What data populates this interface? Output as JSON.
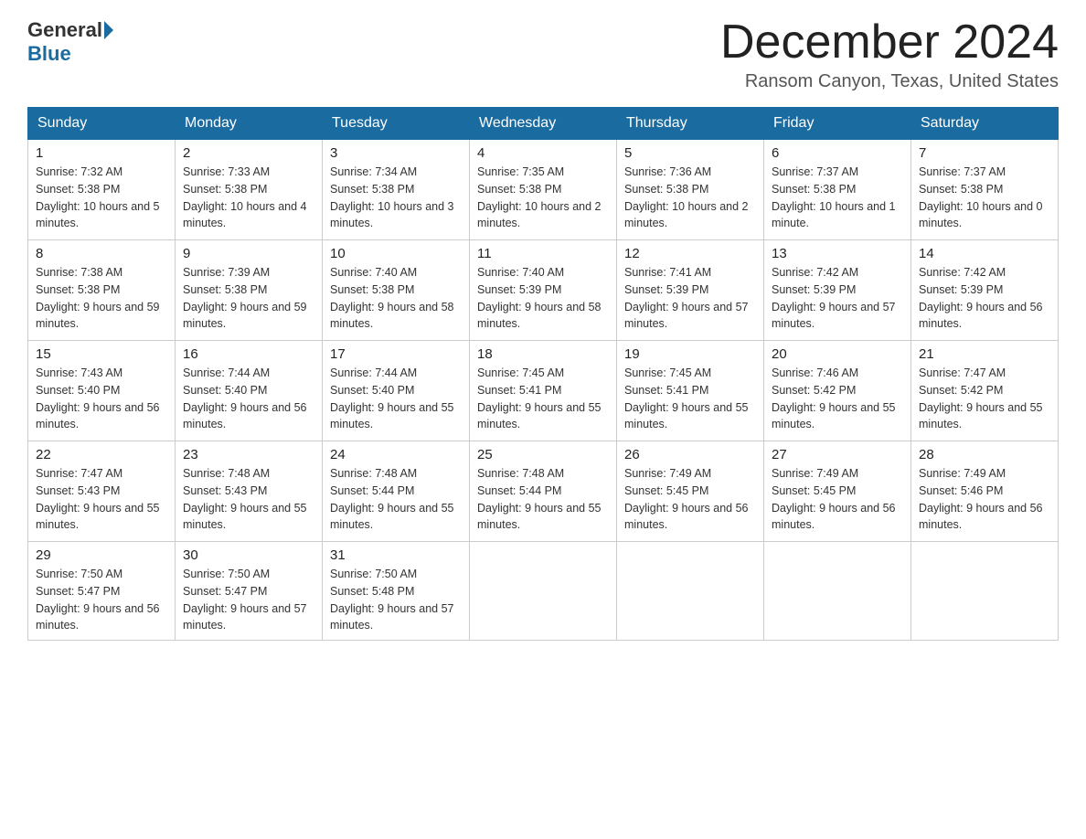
{
  "header": {
    "logo_general": "General",
    "logo_blue": "Blue",
    "title": "December 2024",
    "location": "Ransom Canyon, Texas, United States"
  },
  "weekdays": [
    "Sunday",
    "Monday",
    "Tuesday",
    "Wednesday",
    "Thursday",
    "Friday",
    "Saturday"
  ],
  "weeks": [
    [
      {
        "day": "1",
        "sunrise": "7:32 AM",
        "sunset": "5:38 PM",
        "daylight": "10 hours and 5 minutes."
      },
      {
        "day": "2",
        "sunrise": "7:33 AM",
        "sunset": "5:38 PM",
        "daylight": "10 hours and 4 minutes."
      },
      {
        "day": "3",
        "sunrise": "7:34 AM",
        "sunset": "5:38 PM",
        "daylight": "10 hours and 3 minutes."
      },
      {
        "day": "4",
        "sunrise": "7:35 AM",
        "sunset": "5:38 PM",
        "daylight": "10 hours and 2 minutes."
      },
      {
        "day": "5",
        "sunrise": "7:36 AM",
        "sunset": "5:38 PM",
        "daylight": "10 hours and 2 minutes."
      },
      {
        "day": "6",
        "sunrise": "7:37 AM",
        "sunset": "5:38 PM",
        "daylight": "10 hours and 1 minute."
      },
      {
        "day": "7",
        "sunrise": "7:37 AM",
        "sunset": "5:38 PM",
        "daylight": "10 hours and 0 minutes."
      }
    ],
    [
      {
        "day": "8",
        "sunrise": "7:38 AM",
        "sunset": "5:38 PM",
        "daylight": "9 hours and 59 minutes."
      },
      {
        "day": "9",
        "sunrise": "7:39 AM",
        "sunset": "5:38 PM",
        "daylight": "9 hours and 59 minutes."
      },
      {
        "day": "10",
        "sunrise": "7:40 AM",
        "sunset": "5:38 PM",
        "daylight": "9 hours and 58 minutes."
      },
      {
        "day": "11",
        "sunrise": "7:40 AM",
        "sunset": "5:39 PM",
        "daylight": "9 hours and 58 minutes."
      },
      {
        "day": "12",
        "sunrise": "7:41 AM",
        "sunset": "5:39 PM",
        "daylight": "9 hours and 57 minutes."
      },
      {
        "day": "13",
        "sunrise": "7:42 AM",
        "sunset": "5:39 PM",
        "daylight": "9 hours and 57 minutes."
      },
      {
        "day": "14",
        "sunrise": "7:42 AM",
        "sunset": "5:39 PM",
        "daylight": "9 hours and 56 minutes."
      }
    ],
    [
      {
        "day": "15",
        "sunrise": "7:43 AM",
        "sunset": "5:40 PM",
        "daylight": "9 hours and 56 minutes."
      },
      {
        "day": "16",
        "sunrise": "7:44 AM",
        "sunset": "5:40 PM",
        "daylight": "9 hours and 56 minutes."
      },
      {
        "day": "17",
        "sunrise": "7:44 AM",
        "sunset": "5:40 PM",
        "daylight": "9 hours and 55 minutes."
      },
      {
        "day": "18",
        "sunrise": "7:45 AM",
        "sunset": "5:41 PM",
        "daylight": "9 hours and 55 minutes."
      },
      {
        "day": "19",
        "sunrise": "7:45 AM",
        "sunset": "5:41 PM",
        "daylight": "9 hours and 55 minutes."
      },
      {
        "day": "20",
        "sunrise": "7:46 AM",
        "sunset": "5:42 PM",
        "daylight": "9 hours and 55 minutes."
      },
      {
        "day": "21",
        "sunrise": "7:47 AM",
        "sunset": "5:42 PM",
        "daylight": "9 hours and 55 minutes."
      }
    ],
    [
      {
        "day": "22",
        "sunrise": "7:47 AM",
        "sunset": "5:43 PM",
        "daylight": "9 hours and 55 minutes."
      },
      {
        "day": "23",
        "sunrise": "7:48 AM",
        "sunset": "5:43 PM",
        "daylight": "9 hours and 55 minutes."
      },
      {
        "day": "24",
        "sunrise": "7:48 AM",
        "sunset": "5:44 PM",
        "daylight": "9 hours and 55 minutes."
      },
      {
        "day": "25",
        "sunrise": "7:48 AM",
        "sunset": "5:44 PM",
        "daylight": "9 hours and 55 minutes."
      },
      {
        "day": "26",
        "sunrise": "7:49 AM",
        "sunset": "5:45 PM",
        "daylight": "9 hours and 56 minutes."
      },
      {
        "day": "27",
        "sunrise": "7:49 AM",
        "sunset": "5:45 PM",
        "daylight": "9 hours and 56 minutes."
      },
      {
        "day": "28",
        "sunrise": "7:49 AM",
        "sunset": "5:46 PM",
        "daylight": "9 hours and 56 minutes."
      }
    ],
    [
      {
        "day": "29",
        "sunrise": "7:50 AM",
        "sunset": "5:47 PM",
        "daylight": "9 hours and 56 minutes."
      },
      {
        "day": "30",
        "sunrise": "7:50 AM",
        "sunset": "5:47 PM",
        "daylight": "9 hours and 57 minutes."
      },
      {
        "day": "31",
        "sunrise": "7:50 AM",
        "sunset": "5:48 PM",
        "daylight": "9 hours and 57 minutes."
      },
      null,
      null,
      null,
      null
    ]
  ],
  "labels": {
    "sunrise": "Sunrise:",
    "sunset": "Sunset:",
    "daylight": "Daylight:"
  }
}
